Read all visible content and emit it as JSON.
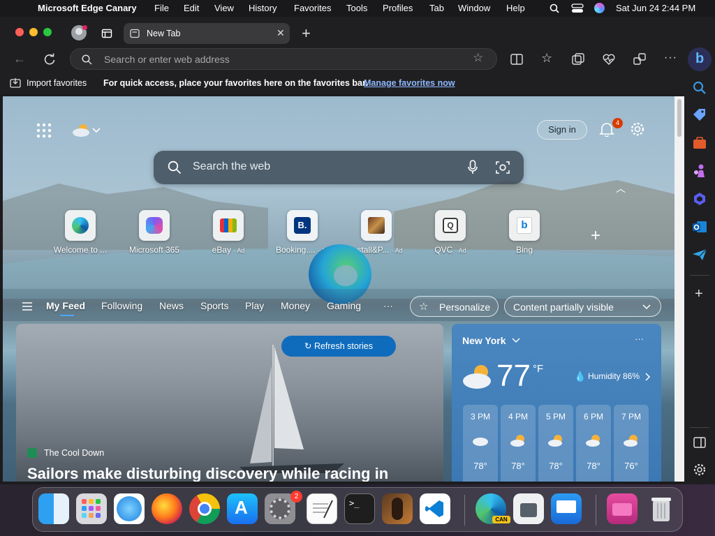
{
  "menubar": {
    "app_name": "Microsoft Edge Canary",
    "items": [
      "File",
      "Edit",
      "View",
      "History",
      "Favorites",
      "Tools",
      "Profiles",
      "Tab",
      "Window",
      "Help"
    ],
    "clock": "Sat Jun 24  2:44 PM"
  },
  "tab": {
    "title": "New Tab"
  },
  "address": {
    "placeholder": "Search or enter web address"
  },
  "favbar": {
    "import_label": "Import favorites",
    "hint": "For quick access, place your favorites here on the favorites bar.",
    "manage_link": "Manage favorites now"
  },
  "ntp": {
    "signin": "Sign in",
    "notif_count": "4",
    "search_placeholder": "Search the web",
    "tiles": [
      {
        "label": "Welcome to ...",
        "ad": ""
      },
      {
        "label": "Microsoft 365",
        "ad": ""
      },
      {
        "label": "eBay",
        "ad": "· Ad"
      },
      {
        "label": "Booking....",
        "ad": "· Ad"
      },
      {
        "label": "Install&P...",
        "ad": "· Ad"
      },
      {
        "label": "QVC",
        "ad": "· Ad"
      },
      {
        "label": "Bing",
        "ad": ""
      }
    ],
    "feed_tabs": [
      "My Feed",
      "Following",
      "News",
      "Sports",
      "Play",
      "Money",
      "Gaming"
    ],
    "more": "···",
    "personalize": "Personalize",
    "content_visibility": "Content partially visible",
    "refresh": "Refresh stories",
    "story": {
      "source": "The Cool Down",
      "headline": "Sailors make disturbing discovery while racing in"
    },
    "weather": {
      "city": "New York",
      "temp": "77",
      "unit": "°F",
      "humidity": "Humidity 86%",
      "hours": [
        {
          "time": "3 PM",
          "temp": "78°"
        },
        {
          "time": "4 PM",
          "temp": "78°"
        },
        {
          "time": "5 PM",
          "temp": "78°"
        },
        {
          "time": "6 PM",
          "temp": "78°"
        },
        {
          "time": "7 PM",
          "temp": "76°"
        }
      ]
    }
  },
  "dock": {
    "settings_badge": "2",
    "edge_badge": "CAN"
  }
}
